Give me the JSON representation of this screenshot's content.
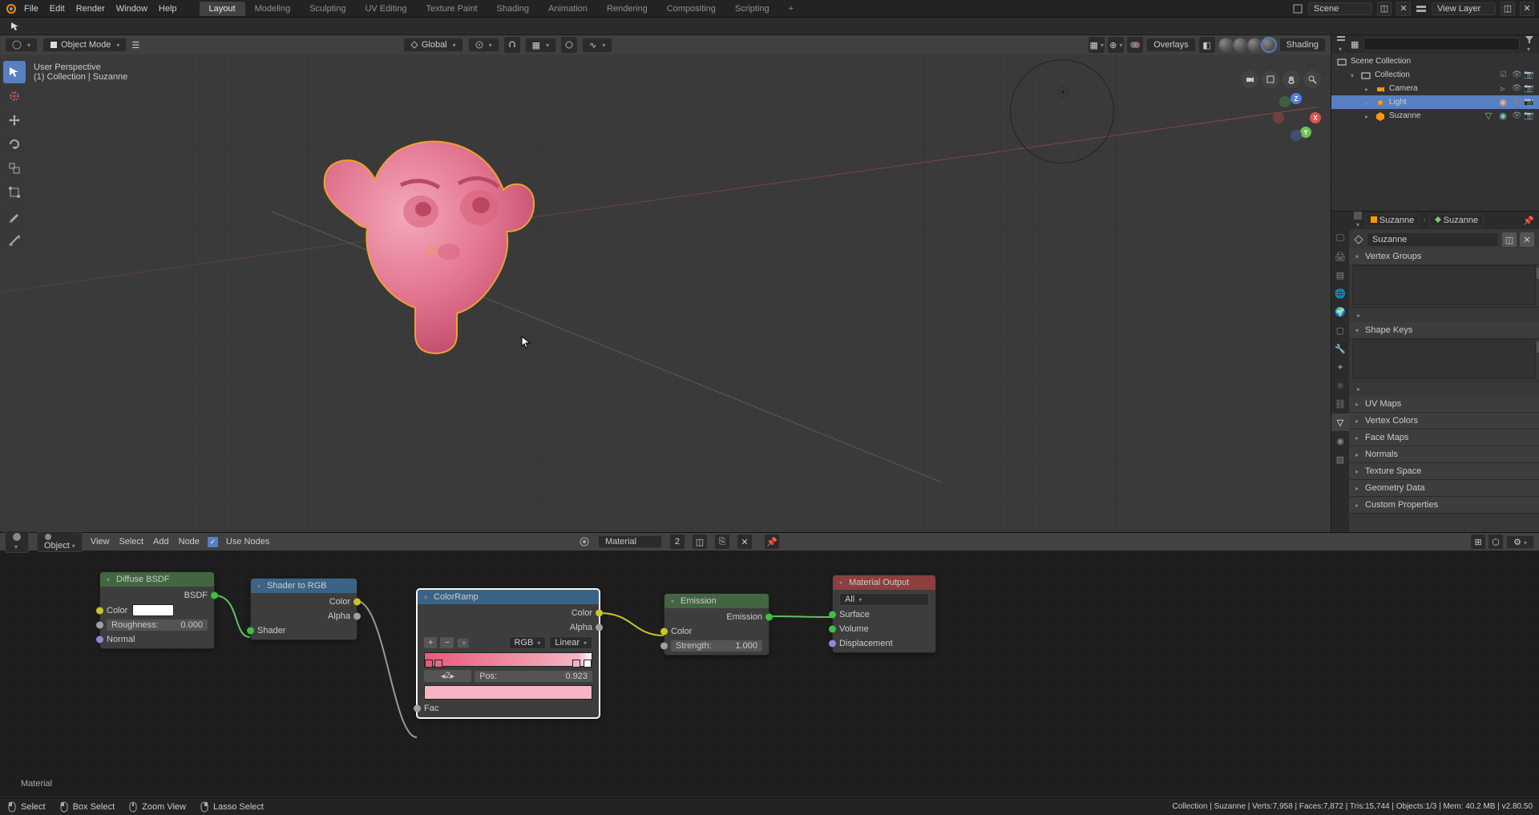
{
  "menubar": [
    "File",
    "Edit",
    "Render",
    "Window",
    "Help"
  ],
  "workspace_tabs": [
    "Layout",
    "Modeling",
    "Sculpting",
    "UV Editing",
    "Texture Paint",
    "Shading",
    "Animation",
    "Rendering",
    "Compositing",
    "Scripting"
  ],
  "active_tab": "Layout",
  "scene_label": "Scene",
  "viewlayer_label": "View Layer",
  "viewport": {
    "mode": "Object Mode",
    "orientation": "Global",
    "perspective_label": "User Perspective",
    "breadcrumb": "(1) Collection | Suzanne",
    "overlays_label": "Overlays",
    "shading_dropdown": "Shading"
  },
  "outliner": {
    "root": "Scene Collection",
    "items": [
      {
        "name": "Collection",
        "indent": 1
      },
      {
        "name": "Camera",
        "indent": 2
      },
      {
        "name": "Light",
        "indent": 2,
        "selected": true
      },
      {
        "name": "Suzanne",
        "indent": 2
      }
    ]
  },
  "properties": {
    "crumb_object": "Suzanne",
    "crumb_mesh": "Suzanne",
    "datablock": "Suzanne",
    "panels": [
      "Vertex Groups",
      "Shape Keys",
      "UV Maps",
      "Vertex Colors",
      "Face Maps",
      "Normals",
      "Texture Space",
      "Geometry Data",
      "Custom Properties"
    ]
  },
  "node_editor": {
    "object_dropdown": "Object",
    "menu": [
      "View",
      "Select",
      "Add",
      "Node"
    ],
    "use_nodes_label": "Use Nodes",
    "material": "Material",
    "material_users": "2",
    "nodes": {
      "diffuse": {
        "title": "Diffuse BSDF",
        "out": "BSDF",
        "color": "Color",
        "roughness_label": "Roughness:",
        "roughness_val": "0.000",
        "normal": "Normal"
      },
      "shader2rgb": {
        "title": "Shader to RGB",
        "color": "Color",
        "alpha": "Alpha",
        "shader": "Shader"
      },
      "colorramp": {
        "title": "ColorRamp",
        "color": "Color",
        "alpha": "Alpha",
        "mode": "RGB",
        "interp": "Linear",
        "index": "2",
        "pos_label": "Pos:",
        "pos_val": "0.923",
        "fac": "Fac"
      },
      "emission": {
        "title": "Emission",
        "out": "Emission",
        "color": "Color",
        "strength_label": "Strength:",
        "strength_val": "1.000"
      },
      "output": {
        "title": "Material Output",
        "target": "All",
        "surface": "Surface",
        "volume": "Volume",
        "displacement": "Displacement"
      }
    },
    "material_label_bottom": "Material"
  },
  "statusbar": {
    "left": [
      {
        "icon": "mouse-left",
        "label": "Select"
      },
      {
        "icon": "mouse-left",
        "label": "Box Select"
      },
      {
        "icon": "mouse-middle",
        "label": "Zoom View"
      },
      {
        "icon": "mouse-right",
        "label": "Lasso Select"
      }
    ],
    "right": "Collection | Suzanne | Verts:7,958 | Faces:7,872 | Tris:15,744 | Objects:1/3 | Mem: 40.2 MB | v2.80.50"
  }
}
